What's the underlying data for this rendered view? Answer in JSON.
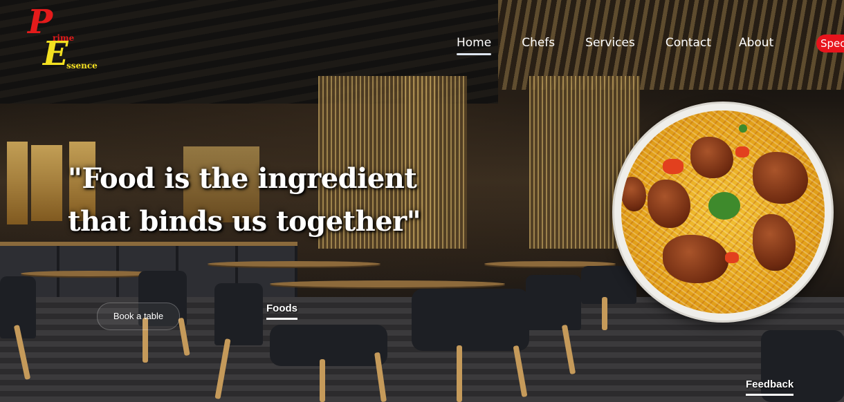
{
  "logo": {
    "letter_p": "P",
    "word_rime": "rime",
    "letter_e": "E",
    "word_ssence": "ssence",
    "colors": {
      "p": "#e41b1b",
      "e": "#f3e021"
    }
  },
  "nav": {
    "items": [
      "Home",
      "Chefs",
      "Services",
      "Contact",
      "About"
    ],
    "active": "Home",
    "special_label": "Spec",
    "special_color": "#e8141c"
  },
  "hero": {
    "quote_line1": "\"Food is the ingredient",
    "quote_line2": "that binds us together\""
  },
  "actions": {
    "book_label": "Book a table",
    "foods_label": "Foods",
    "feedback_label": "Feedback"
  },
  "icons": [
    "biryani-bowl-image",
    "restaurant-background-image"
  ]
}
